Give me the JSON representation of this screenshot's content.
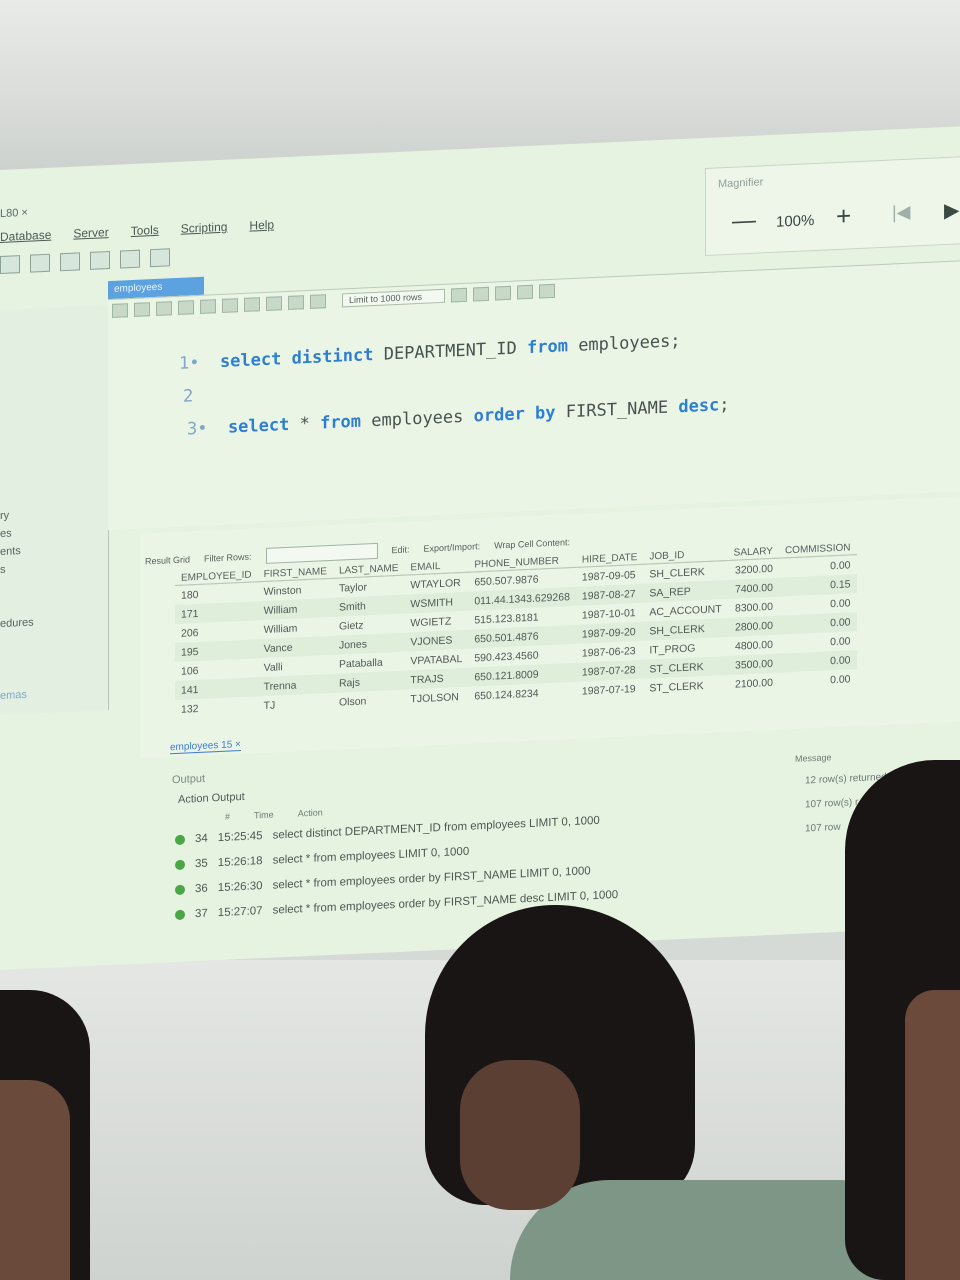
{
  "window": {
    "tab_title": "L80 ×"
  },
  "menu": [
    "Database",
    "Server",
    "Tools",
    "Scripting",
    "Help"
  ],
  "magnifier": {
    "title": "Magnifier",
    "zoom": "100%"
  },
  "query_tab": "employees",
  "editor_toolbar": {
    "limit": "Limit to 1000 rows"
  },
  "sql": [
    {
      "num": "1",
      "dot": "•",
      "kw1": "select distinct",
      "mid": " DEPARTMENT_ID ",
      "kw2": "from",
      "rest": " employees;"
    },
    {
      "num": "2"
    },
    {
      "num": "3",
      "dot": "•",
      "kw1": "select",
      "mid": " * ",
      "kw2": "from",
      "mid2": " employees ",
      "kw3": "order by",
      "mid3": " FIRST_NAME ",
      "kw4": "desc",
      "rest": ";"
    }
  ],
  "left_panel": [
    "ry",
    "es",
    "ents",
    "s",
    "edures",
    "emas"
  ],
  "result_toolbar": {
    "grid": "Result Grid",
    "filter": "Filter Rows:",
    "edit": "Edit:",
    "export": "Export/Import:",
    "wrap": "Wrap Cell Content:"
  },
  "columns": [
    "EMPLOYEE_ID",
    "FIRST_NAME",
    "LAST_NAME",
    "EMAIL",
    "PHONE_NUMBER",
    "HIRE_DATE",
    "JOB_ID",
    "SALARY",
    "COMMISSION"
  ],
  "rows": [
    [
      "180",
      "Winston",
      "Taylor",
      "WTAYLOR",
      "650.507.9876",
      "1987-09-05",
      "SH_CLERK",
      "3200.00",
      "0.00"
    ],
    [
      "171",
      "William",
      "Smith",
      "WSMITH",
      "011.44.1343.629268",
      "1987-08-27",
      "SA_REP",
      "7400.00",
      "0.15"
    ],
    [
      "206",
      "William",
      "Gietz",
      "WGIETZ",
      "515.123.8181",
      "1987-10-01",
      "AC_ACCOUNT",
      "8300.00",
      "0.00"
    ],
    [
      "195",
      "Vance",
      "Jones",
      "VJONES",
      "650.501.4876",
      "1987-09-20",
      "SH_CLERK",
      "2800.00",
      "0.00"
    ],
    [
      "106",
      "Valli",
      "Pataballa",
      "VPATABAL",
      "590.423.4560",
      "1987-06-23",
      "IT_PROG",
      "4800.00",
      "0.00"
    ],
    [
      "141",
      "Trenna",
      "Rajs",
      "TRAJS",
      "650.121.8009",
      "1987-07-28",
      "ST_CLERK",
      "3500.00",
      "0.00"
    ],
    [
      "132",
      "TJ",
      "Olson",
      "TJOLSON",
      "650.124.8234",
      "1987-07-19",
      "ST_CLERK",
      "2100.00",
      "0.00"
    ]
  ],
  "result_tab": "employees 15 ×",
  "output": {
    "label": "Output",
    "mode": "Action Output",
    "headers": {
      "num": "#",
      "time": "Time",
      "action": "Action",
      "message": "Message"
    },
    "entries": [
      {
        "num": "34",
        "time": "15:25:45",
        "action": "select distinct DEPARTMENT_ID from employees LIMIT 0, 1000",
        "message": "12 row(s) returned"
      },
      {
        "num": "35",
        "time": "15:26:18",
        "action": "select * from employees LIMIT 0, 1000",
        "message": "107 row(s) r"
      },
      {
        "num": "36",
        "time": "15:26:30",
        "action": "select * from employees order by FIRST_NAME LIMIT 0, 1000",
        "message": "107 row"
      },
      {
        "num": "37",
        "time": "15:27:07",
        "action": "select * from employees order by FIRST_NAME desc LIMIT 0, 1000",
        "message": ""
      }
    ]
  }
}
